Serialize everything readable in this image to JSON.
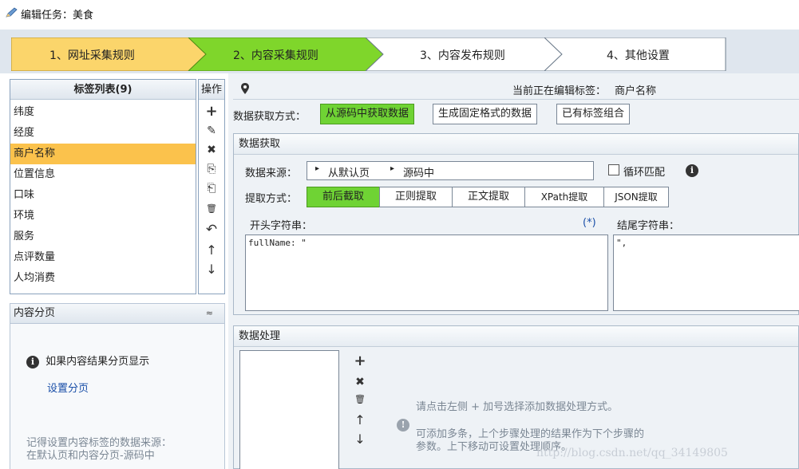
{
  "window": {
    "title": "编辑任务：美食",
    "icon": "pencil-icon"
  },
  "wizard": {
    "steps": [
      {
        "label": "1、网址采集规则",
        "state": "done"
      },
      {
        "label": "2、内容采集规则",
        "state": "active"
      },
      {
        "label": "3、内容发布规则",
        "state": "todo"
      },
      {
        "label": "4、其他设置",
        "state": "todo"
      }
    ],
    "colors": {
      "done": "#fbd56b",
      "active": "#7fd62b",
      "todo": "#ffffff"
    }
  },
  "tag_list": {
    "header": "标签列表(9)",
    "items": [
      "纬度",
      "经度",
      "商户名称",
      "位置信息",
      "口味",
      "环境",
      "服务",
      "点评数量",
      "人均消费"
    ],
    "selected_index": 2,
    "selected_color": "#fbc24c"
  },
  "ops": {
    "header": "操作",
    "icons": [
      "plus-icon",
      "pencil-icon",
      "delete-x-icon",
      "copy-icon",
      "paste-icon",
      "trash-icon",
      "undo-icon",
      "move-up-icon",
      "move-down-icon"
    ],
    "glyphs": [
      "+",
      "✎",
      "✖",
      "⎘",
      "⎗",
      "🗑",
      "↶",
      "↑",
      "↓"
    ]
  },
  "pagination": {
    "header": "内容分页",
    "collapse_glyph": "≈",
    "info_text": "如果内容结果分页显示",
    "link": "设置分页",
    "note_line1": "记得设置内容标签的数据来源：",
    "note_line2": "在默认页和内容分页-源码中"
  },
  "editor": {
    "current_tag_prefix": "当前正在编辑标签：",
    "current_tag": "商户名称",
    "method_label": "数据获取方式：",
    "methods": [
      "从源码中获取数据",
      "生成固定格式的数据",
      "已有标签组合"
    ],
    "method_active": 0,
    "fetch": {
      "section_title": "数据获取",
      "source_label": "数据来源：",
      "source_parts": [
        "从默认页",
        "源码中"
      ],
      "loop_label": "循环匹配",
      "loop_checked": false,
      "extract_label": "提取方式：",
      "extract_methods": [
        "前后截取",
        "正则提取",
        "正文提取",
        "XPath提取",
        "JSON提取"
      ],
      "extract_active": 0,
      "start_label": "开头字符串：",
      "wildcard": "(*)",
      "end_label": "结尾字符串：",
      "start_value": "fullName: \"",
      "end_value": "\","
    },
    "process": {
      "section_title": "数据处理",
      "hint1": "请点击左侧 + 加号选择添加数据处理方式。",
      "hint2_line1": "可添加多条，上个步骤处理的结果作为下个步骤的",
      "hint2_line2": "参数。上下移动可设置处理顺序。",
      "side_icons": [
        "plus-icon",
        "delete-x-icon",
        "trash-icon",
        "move-up-icon",
        "move-down-icon"
      ],
      "side_glyphs": [
        "+",
        "✖",
        "🗑",
        "↑",
        "↓"
      ]
    }
  },
  "watermark": "http://blog.csdn.net/qq_34149805"
}
